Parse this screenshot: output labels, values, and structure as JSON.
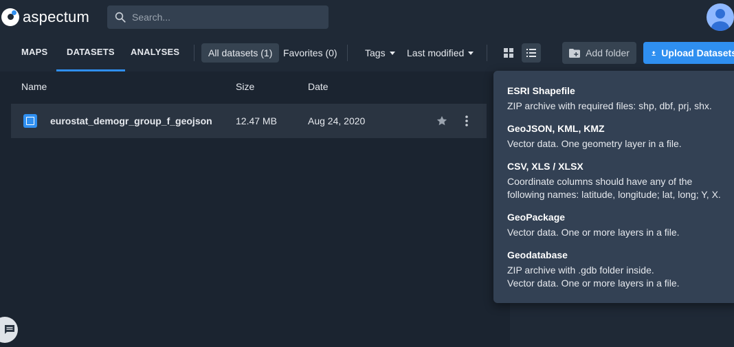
{
  "app": {
    "name": "aspectum"
  },
  "search": {
    "placeholder": "Search..."
  },
  "nav": {
    "tabs": [
      {
        "label": "MAPS"
      },
      {
        "label": "DATASETS"
      },
      {
        "label": "ANALYSES"
      }
    ],
    "filters": [
      {
        "label": "All datasets (1)"
      },
      {
        "label": "Favorites (0)"
      }
    ],
    "tags_label": "Tags",
    "sort_label": "Last modified",
    "add_folder_label": "Add folder",
    "upload_label": "Upload Datasets"
  },
  "table": {
    "columns": [
      "Name",
      "Size",
      "Date"
    ],
    "rows": [
      {
        "name": "eurostat_demogr_group_f_geojson",
        "size": "12.47 MB",
        "date": "Aug 24, 2020"
      }
    ]
  },
  "formats": [
    {
      "title": "ESRI Shapefile",
      "desc": [
        "ZIP archive with required files: shp, dbf, prj, shx."
      ]
    },
    {
      "title": "GeoJSON, KML, KMZ",
      "desc": [
        "Vector data. One geometry layer in a file."
      ]
    },
    {
      "title": "CSV, XLS / XLSX",
      "desc": [
        "Coordinate columns should have any of the",
        "following names: latitude, longitude; lat, long; Y, X."
      ]
    },
    {
      "title": "GeoPackage",
      "desc": [
        "Vector data. One or more layers in a file."
      ]
    },
    {
      "title": "Geodatabase",
      "desc": [
        "ZIP archive with .gdb folder inside.",
        "Vector data. One or more layers in a file."
      ]
    }
  ],
  "colors": {
    "accent": "#2f8ff0",
    "background": "#1b2430",
    "popover": "#334154"
  }
}
